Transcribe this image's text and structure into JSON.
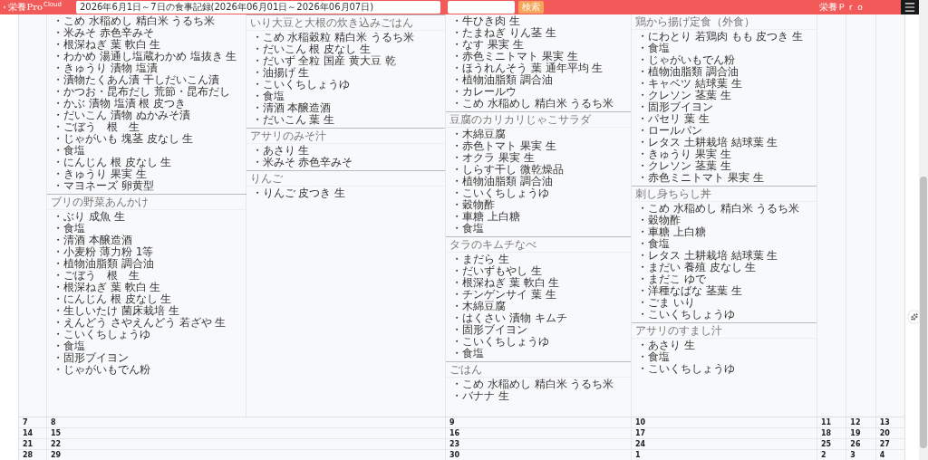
{
  "header": {
    "logo": {
      "name": "栄養Pro",
      "tag": "Cloud"
    },
    "search": {
      "value": "2026年6月1日～7日の食事記録(2026年06月01日～2026年06月07日)"
    },
    "search_button": "検索",
    "brand": "栄養Ｐｒｏ"
  },
  "calendar": {
    "first_week": [
      {
        "meals": [
          {
            "items": [
              "・こめ 水稲めし 精白米 うるち米",
              "・米みそ 赤色辛みそ",
              "・根深ねぎ 葉 軟白 生",
              "・わかめ 湯通し塩蔵わかめ 塩抜き 生",
              "・きゅうり 漬物 塩漬",
              "・漬物たくあん漬 干しだいこん漬",
              "・かつお・昆布だし 荒節・昆布だし",
              "・かぶ 漬物 塩漬 根 皮つき",
              "・だいこん 漬物 ぬかみそ漬",
              "・ごぼう　根　生",
              "・じゃがいも 塊茎 皮なし 生",
              "・食塩",
              "・にんじん 根 皮なし 生",
              "・きゅうり 果実 生",
              "・マヨネーズ 卵黄型"
            ]
          },
          {
            "title": "ブリの野菜あんかけ",
            "items": [
              "・ぶり 成魚 生",
              "・食塩",
              "・清酒 本醸造酒",
              "・小麦粉 薄力粉 1等",
              "・植物油脂類 調合油",
              "・ごぼう　根　生",
              "・根深ねぎ 葉 軟白 生",
              "・にんじん 根 皮なし 生",
              "・生しいたけ 菌床栽培 生",
              "・えんどう さやえんどう 若ざや 生",
              "・こいくちしょうゆ",
              "・食塩",
              "・固形ブイヨン",
              "・じゃがいもでん粉"
            ]
          },
          {
            "title": "いり大豆と大根の炊き込みごはん",
            "items": [
              "・こめ 水稲穀粒 精白米 うるち米",
              "・だいこん 根 皮なし 生",
              "・だいず 全粒 国産 黄大豆 乾",
              "・油揚げ 生",
              "・こいくちしょうゆ",
              "・食塩",
              "・清酒 本醸造酒",
              "・だいこん 葉 生"
            ]
          },
          {
            "title": "アサリのみそ汁",
            "items": [
              "・あさり 生",
              "・米みそ 赤色辛みそ"
            ]
          },
          {
            "title": "りんご",
            "items": [
              "・りんご 皮つき 生"
            ]
          }
        ]
      },
      {
        "meals": [
          {
            "items": [
              "・牛ひき肉 生",
              "・たまねぎ りん茎 生",
              "・なす 果実 生",
              "・赤色ミニトマト 果実 生",
              "・ほうれんそう 葉 通年平均 生",
              "・植物油脂類 調合油",
              "・カレールウ",
              "・こめ 水稲めし 精白米 うるち米"
            ]
          },
          {
            "title": "豆腐のカリカリじゃこサラダ",
            "items": [
              "・木綿豆腐",
              "・赤色トマト 果実 生",
              "・オクラ 果実 生",
              "・しらす干し 微乾燥品",
              "・植物油脂類 調合油",
              "・こいくちしょうゆ",
              "・穀物酢",
              "・車糖 上白糖",
              "・食塩"
            ]
          },
          {
            "title": "タラのキムチなべ",
            "items": [
              "・まだら 生",
              "・だいずもやし 生",
              "・根深ねぎ 葉 軟白 生",
              "・チンゲンサイ 葉 生",
              "・木綿豆腐",
              "・はくさい 漬物 キムチ",
              "・固形ブイヨン",
              "・こいくちしょうゆ",
              "・食塩"
            ]
          },
          {
            "title": "ごはん",
            "items": [
              "・こめ 水稲めし 精白米 うるち米",
              "・バナナ 生"
            ]
          }
        ]
      },
      {
        "meals": [
          {
            "title": "鶏から揚げ定食（外食）",
            "items": [
              "・にわとり 若鶏肉 もも 皮つき 生",
              "・食塩",
              "・じゃがいもでん粉",
              "・植物油脂類 調合油",
              "・キャベツ 結球葉 生",
              "・クレソン 茎葉 生",
              "・固形ブイヨン",
              "・パセリ 葉 生",
              "・ロールパン",
              "・レタス 土耕栽培 結球葉 生",
              "・きゅうり 果実 生",
              "・クレソン 茎葉 生",
              "・赤色ミニトマト 果実 生"
            ]
          },
          {
            "title": "刺し身ちらし丼",
            "items": [
              "・こめ 水稲めし 精白米 うるち米",
              "・穀物酢",
              "・車糖 上白糖",
              "・食塩",
              "・レタス 土耕栽培 結球葉 生",
              "・まだい 養殖 皮なし 生",
              "・まだこ ゆで",
              "・洋種なばな 茎葉 生",
              "・ごま いり",
              "・こいくちしょうゆ"
            ]
          },
          {
            "title": "アサリのすまし汁",
            "items": [
              "・あさり 生",
              "・食塩",
              "・こいくちしょうゆ"
            ]
          }
        ]
      }
    ],
    "weeks": [
      [
        "7",
        "8",
        "9",
        "10",
        "11",
        "12",
        "13"
      ],
      [
        "14",
        "15",
        "16",
        "17",
        "18",
        "19",
        "20"
      ],
      [
        "21",
        "22",
        "23",
        "24",
        "25",
        "26",
        "27"
      ],
      [
        "28",
        "29",
        "30",
        "1",
        "2",
        "3",
        "4"
      ]
    ]
  }
}
